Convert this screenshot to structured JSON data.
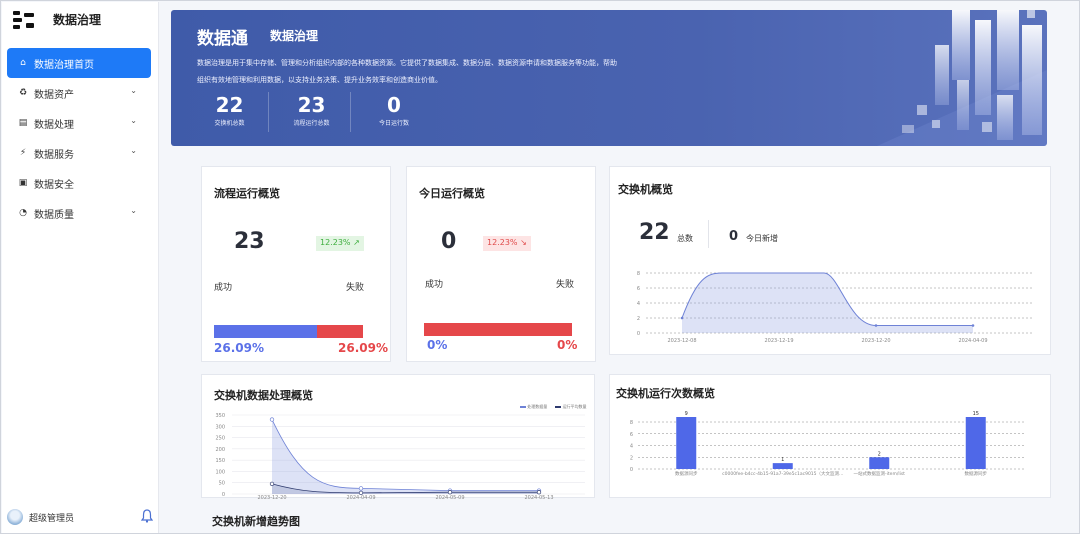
{
  "sidebar": {
    "app_title": "数据治理",
    "items": [
      {
        "label": "数据治理首页",
        "icon": "home-icon"
      },
      {
        "label": "数据资产",
        "icon": "asset-icon"
      },
      {
        "label": "数据处理",
        "icon": "process-icon"
      },
      {
        "label": "数据服务",
        "icon": "lightning-icon"
      },
      {
        "label": "数据安全",
        "icon": "camera-icon"
      },
      {
        "label": "数据质量",
        "icon": "gauge-icon"
      }
    ],
    "user_name": "超级管理员"
  },
  "banner": {
    "title": "数据通",
    "subtitle": "数据治理",
    "desc_line1": "数据治理是用于集中存储、管理和分析组织内部的各种数据资源。它提供了数据集成、数据分层、数据资源申请和数据服务等功能，帮助",
    "desc_line2": "组织有效地管理和利用数据，以支持业务决策、提升业务效率和创造商业价值。",
    "stats": [
      {
        "value": "22",
        "label": "交换机总数"
      },
      {
        "value": "23",
        "label": "流程运行总数"
      },
      {
        "value": "0",
        "label": "今日运行数"
      }
    ]
  },
  "flow_card": {
    "title": "流程运行概览",
    "total": "23",
    "badge": "12.23%",
    "success_label": "成功",
    "fail_label": "失败",
    "success_pct": "26.09%",
    "fail_pct": "26.09%",
    "success_ratio": 0.69
  },
  "today_card": {
    "title": "今日运行概览",
    "total": "0",
    "badge": "12.23%",
    "success_label": "成功",
    "fail_label": "失败",
    "success_pct": "0%",
    "fail_pct": "0%",
    "success_ratio": 0
  },
  "switch_card": {
    "title": "交换机概览",
    "total": "22",
    "total_label": "总数",
    "new_today": "0",
    "new_label": "今日新增"
  },
  "process_card": {
    "title": "交换机数据处理概览"
  },
  "runs_card": {
    "title": "交换机运行次数概览"
  },
  "trend_title": "交换机新增趋势图",
  "chart_data": [
    {
      "type": "area",
      "x": [
        "2023-12-08",
        "2023-12-19",
        "2023-12-20",
        "2024-04-09"
      ],
      "values": [
        2,
        9,
        1,
        1
      ],
      "ylim": [
        0,
        8
      ],
      "yticks": [
        "0",
        "2",
        "4",
        "6",
        "8"
      ],
      "color": "#6e82d6"
    },
    {
      "type": "area",
      "x": [
        "2023-12-20",
        "2024-04-09",
        "2024-05-09",
        "2024-05-13"
      ],
      "series": [
        {
          "name": "处理数据量",
          "values": [
            330,
            25,
            15,
            15
          ]
        },
        {
          "name": "运行平均数量",
          "values": [
            45,
            5,
            8,
            8
          ]
        }
      ],
      "ylim": [
        0,
        350
      ],
      "yticks": [
        "0",
        "50",
        "100",
        "150",
        "200",
        "250",
        "300",
        "350"
      ]
    },
    {
      "type": "bar",
      "categories": [
        "数据源同步",
        "c0000fee-b4cc-4b15-91a7-39e5c1ac9015（大文监测...",
        "一站式数据监测-item/list",
        "数据源同步"
      ],
      "values": [
        9,
        1,
        2,
        15
      ],
      "ylim": [
        0,
        8
      ],
      "yticks": [
        "0",
        "2",
        "4",
        "6",
        "8"
      ]
    }
  ]
}
